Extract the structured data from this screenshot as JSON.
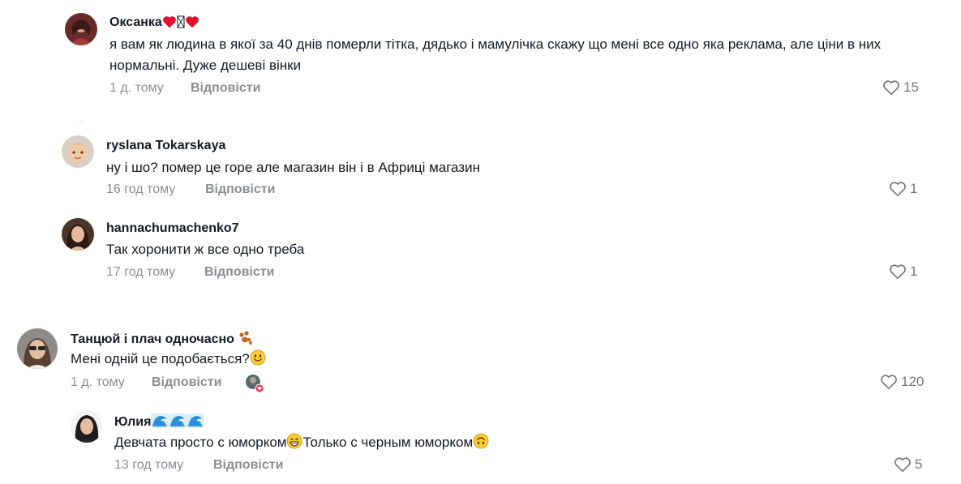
{
  "comments": [
    {
      "username": "Оксанка",
      "text": "я вам як людина в якої за 40 днів померли тітка, дядько і мамулічка скажу що мені все одно яка реклама, але ціни в них нормальні. Дуже дешеві вінки",
      "time": "1 д. тому",
      "reply_label": "Відповісти",
      "likes": "15"
    },
    {
      "username": "ryslana Tokarskaya",
      "text": "ну і шо? помер це горе але магазин він і в Африці магазин",
      "time": "16 год тому",
      "reply_label": "Відповісти",
      "likes": "1"
    },
    {
      "username": "hannachumachenko7",
      "text": "Так хоронити ж все одно треба",
      "time": "17 год тому",
      "reply_label": "Відповісти",
      "likes": "1"
    },
    {
      "username": "Танцюй і плач одночасно",
      "text": "Мені одній це подобається?",
      "time": "1 д. тому",
      "reply_label": "Відповісти",
      "likes": "120"
    },
    {
      "username": "Юлия",
      "text_part1": "Девчата просто с юморком",
      "text_part2": "Только с черным юморком",
      "time": "13 год тому",
      "reply_label": "Відповісти",
      "likes": "5"
    }
  ],
  "icons": {
    "heart_outline": "heart-outline-icon",
    "heart_red": "red-heart-icon",
    "smiley": "smiley-icon",
    "wave": "wave-icon",
    "grin": "grin-icon",
    "upside_down": "upside-down-face-icon",
    "paw": "paw-icon"
  },
  "colors": {
    "text": "#161823",
    "muted": "rgba(22,24,35,0.5)",
    "heart_red": "#e0102a",
    "emoji_yellow": "#ffcc33",
    "wave_blue": "#2a8fd6"
  }
}
